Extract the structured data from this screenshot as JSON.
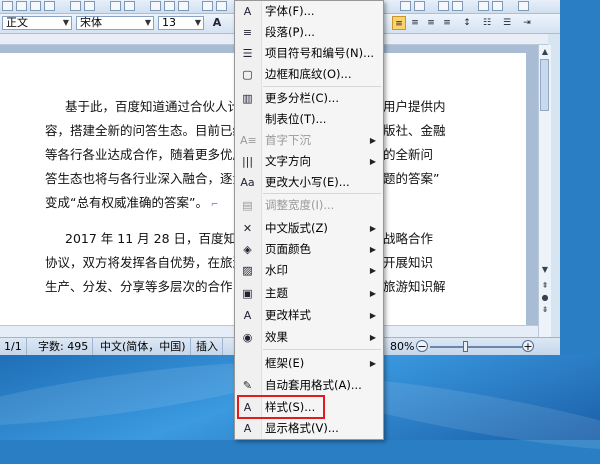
{
  "format_toolbar": {
    "style_value": "正文",
    "font_value": "宋体",
    "size_value": "13",
    "style_label": "A",
    "align_buttons": [
      "align-left",
      "align-center",
      "align-right",
      "justify"
    ]
  },
  "document": {
    "paragraphs": [
      "基于此，百度知道通过合伙人计",
      "容，搭建全新的问答生态。目前已经",
      "等各行各业达成合作，随着更多优质",
      "答生态也将与各行业深入融合，逐步",
      "变成“总有权威准确的答案”。",
      "2017 年 11 月 28 日，百度知道",
      "协议，双方将发挥各自优势，在旅游",
      "生产、分发、分享等多层次的合作，"
    ],
    "paragraphs_right": [
      "用户提供内",
      "版社、金融",
      "的全新问",
      "题的答案”",
      "",
      "战略合作",
      "开展知识",
      "旅游知识解"
    ]
  },
  "status_bar": {
    "page": "1/1",
    "words": "字数: 495",
    "language": "中文(简体，中国)",
    "insert": "插入",
    "zoom": "80%"
  },
  "menu": {
    "items": [
      {
        "label": "字体(F)...",
        "icon": "font-A-icon",
        "glyph": "A",
        "disabled": false,
        "submenu": false
      },
      {
        "label": "段落(P)...",
        "icon": "paragraph-icon",
        "glyph": "≡",
        "disabled": false,
        "submenu": false
      },
      {
        "label": "项目符号和编号(N)...",
        "icon": "bullets-icon",
        "glyph": "☰",
        "disabled": false,
        "submenu": false
      },
      {
        "label": "边框和底纹(O)...",
        "icon": "borders-icon",
        "glyph": "▢",
        "disabled": false,
        "submenu": false
      },
      {
        "label": "更多分栏(C)...",
        "icon": "columns-icon",
        "glyph": "▥",
        "disabled": false,
        "submenu": false
      },
      {
        "label": "制表位(T)...",
        "icon": "tabs-icon",
        "glyph": "",
        "disabled": false,
        "submenu": false
      },
      {
        "label": "首字下沉",
        "icon": "drop-cap-icon",
        "glyph": "A≡",
        "disabled": true,
        "submenu": true
      },
      {
        "label": "文字方向",
        "icon": "text-direction-icon",
        "glyph": "|||",
        "disabled": false,
        "submenu": true
      },
      {
        "label": "更改大小写(E)...",
        "icon": "change-case-icon",
        "glyph": "Aa",
        "disabled": false,
        "submenu": false
      },
      {
        "label": "调整宽度(I)...",
        "icon": "adjust-width-icon",
        "glyph": "▤",
        "disabled": true,
        "submenu": false
      },
      {
        "label": "中文版式(Z)",
        "icon": "chinese-layout-icon",
        "glyph": "✕",
        "disabled": false,
        "submenu": true
      },
      {
        "label": "页面颜色",
        "icon": "page-color-icon",
        "glyph": "◈",
        "disabled": false,
        "submenu": true
      },
      {
        "label": "水印",
        "icon": "watermark-icon",
        "glyph": "▨",
        "disabled": false,
        "submenu": true
      },
      {
        "label": "主题",
        "icon": "theme-icon",
        "glyph": "▣",
        "disabled": false,
        "submenu": true
      },
      {
        "label": "更改样式",
        "icon": "change-styles-icon",
        "glyph": "A",
        "disabled": false,
        "submenu": true
      },
      {
        "label": "效果",
        "icon": "effects-icon",
        "glyph": "◉",
        "disabled": false,
        "submenu": true
      },
      {
        "label": "框架(E)",
        "icon": "frames-icon",
        "glyph": "",
        "disabled": false,
        "submenu": true
      },
      {
        "label": "自动套用格式(A)...",
        "icon": "autoformat-icon",
        "glyph": "✎",
        "disabled": false,
        "submenu": false
      },
      {
        "label": "样式(S)...",
        "icon": "styles-icon",
        "glyph": "A",
        "disabled": false,
        "submenu": false
      },
      {
        "label": "显示格式(V)...",
        "icon": "reveal-format-icon",
        "glyph": "A",
        "disabled": false,
        "submenu": false
      }
    ]
  },
  "colors": {
    "menu_bg": "#f5f5f5",
    "highlight_box": "#e21b1b",
    "active_align": "#fbd36b"
  }
}
